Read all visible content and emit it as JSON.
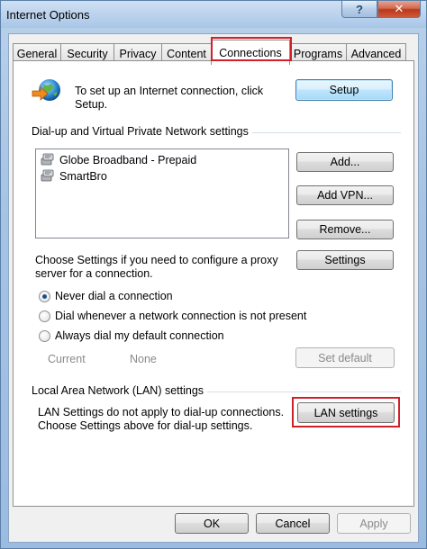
{
  "window": {
    "title": "Internet Options",
    "help_glyph": "?",
    "close_glyph": "✕"
  },
  "tabs": [
    {
      "label": "General"
    },
    {
      "label": "Security"
    },
    {
      "label": "Privacy"
    },
    {
      "label": "Content"
    },
    {
      "label": "Connections",
      "active": true
    },
    {
      "label": "Programs"
    },
    {
      "label": "Advanced"
    }
  ],
  "setup": {
    "text": "To set up an Internet connection, click Setup.",
    "button": "Setup",
    "icon": "globe-network-icon"
  },
  "dialup": {
    "group_label": "Dial-up and Virtual Private Network settings",
    "connections": [
      {
        "name": "Globe Broadband - Prepaid",
        "icon": "dialup-connection-icon"
      },
      {
        "name": "SmartBro",
        "icon": "dialup-connection-icon"
      }
    ],
    "add_button": "Add...",
    "add_vpn_button": "Add VPN...",
    "remove_button": "Remove...",
    "proxy_text": "Choose Settings if you need to configure a proxy server for a connection.",
    "settings_button": "Settings",
    "options": [
      {
        "label": "Never dial a connection",
        "checked": true
      },
      {
        "label": "Dial whenever a network connection is not present",
        "checked": false
      },
      {
        "label": "Always dial my default connection",
        "checked": false
      }
    ],
    "current_label": "Current",
    "current_value": "None",
    "set_default_button": "Set default"
  },
  "lan": {
    "group_label": "Local Area Network (LAN) settings",
    "text": "LAN Settings do not apply to dial-up connections. Choose Settings above for dial-up settings.",
    "button": "LAN settings"
  },
  "footer": {
    "ok": "OK",
    "cancel": "Cancel",
    "apply": "Apply"
  },
  "colors": {
    "highlight": "#d0202a",
    "title_bar": "#bad2ec",
    "close": "#c7462a"
  }
}
